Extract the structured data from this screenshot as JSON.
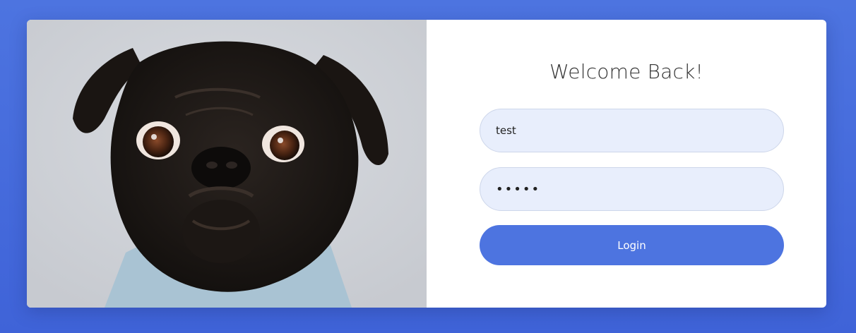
{
  "login": {
    "title": "Welcome Back!",
    "username_value": "test",
    "password_value": "•••••",
    "login_label": "Login"
  },
  "colors": {
    "background": "#4d74e0",
    "input_background": "#e8eefc",
    "button": "#4d74e0"
  }
}
